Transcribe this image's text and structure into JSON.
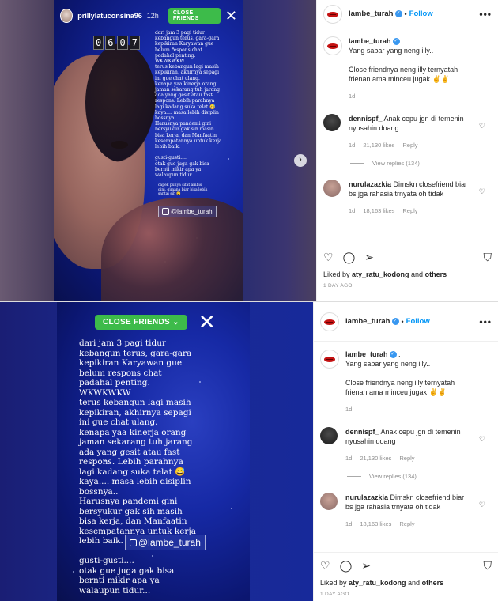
{
  "top_story": {
    "username": "prillylatuconsina96",
    "time": "12h",
    "badge": "CLOSE FRIENDS",
    "close": "✕",
    "clock": [
      "0",
      "6",
      "0",
      "7"
    ],
    "text": "dari jam 3 pagi tidur\nkebangun terus, gara-gara\nkepikiran Karyawan gue\nbelum respons chat\npadahal penting.\nWKWKWKW\nterus kebangun lagi masih\nkepikiran, akhirnya sepagi\nini gue chat ulang.\nkenapa yaa kinerja orang\njaman sekarang tuh jarang\nada yang gesit atau fast\nrespons. Lebih parahnya\nlagi kadang suka telat 😅\nkaya.... masa lebih disiplin\nbossnya..\nHarusnya pandemi gini\nbersyukur gak sih masih\nbisa kerja, dan Manfaatin\nkesempatannya untuk kerja\nlebih baik.\n\ngusti-gusti....\notak gue juga gak bisa\nbernti mikir apa ya\nwalaupun tidur...",
    "small_text": "capek punya sifat ambis\ngini. gimana biar bisa lebih\nsantai sih 😩",
    "watermark": "@lambe_turah",
    "next_arrow": "›"
  },
  "bottom_story": {
    "badge": "CLOSE FRIENDS",
    "chevron": "⌄",
    "close": "✕",
    "text": "dari jam 3 pagi tidur\nkebangun terus, gara-gara\nkepikiran Karyawan gue\nbelum respons chat\npadahal penting.\nWKWKWKW\nterus kebangun lagi masih\nkepikiran, akhirnya sepagi\nini gue chat ulang.\nkenapa yaa kinerja orang\njaman sekarang tuh jarang\nada yang gesit atau fast\nrespons. Lebih parahnya\nlagi kadang suka telat 😅\nkaya.... masa lebih disiplin\nbossnya..\nHarusnya pandemi gini\nbersyukur gak sih masih\nbisa kerja, dan Manfaatin\nkesempatannya untuk kerja\nlebih baik.\n\ngusti-gusti....\notak gue juga gak bisa\nbernti mikir apa ya\nwalaupun tidur...",
    "watermark": "@lambe_turah"
  },
  "ig": {
    "account": "lambe_turah",
    "verified": "✓",
    "dot": "•",
    "follow": "Follow",
    "more": "•••",
    "caption": {
      "username": "lambe_turah",
      "suffix": " .",
      "line1": "Yang sabar yang neng illy..",
      "line2": "Close friendnya neng illy ternyatah",
      "line3": "frienan ama minceu jugak ✌✌",
      "age": "1d"
    },
    "comments": [
      {
        "username": "dennispf_",
        "text": " Anak cepu jgn di temenin nyusahin doang",
        "age": "1d",
        "likes": "21,130 likes",
        "reply": "Reply",
        "view_replies": "View replies (134)",
        "heart": "♡"
      },
      {
        "username": "nurulazazkia",
        "text": " Dimskn closefriend biar bs jga rahasia trnyata oh tidak",
        "age": "1d",
        "likes": "18,163 likes",
        "reply": "Reply",
        "heart": "♡"
      }
    ],
    "actions": {
      "like": "♡",
      "comment": "◯",
      "share": "➢",
      "save": "⛉"
    },
    "liked_prefix": "Liked by ",
    "liked_user": "aty_ratu_kodong",
    "liked_mid": " and ",
    "liked_others": "others",
    "ago": "1 DAY AGO"
  }
}
